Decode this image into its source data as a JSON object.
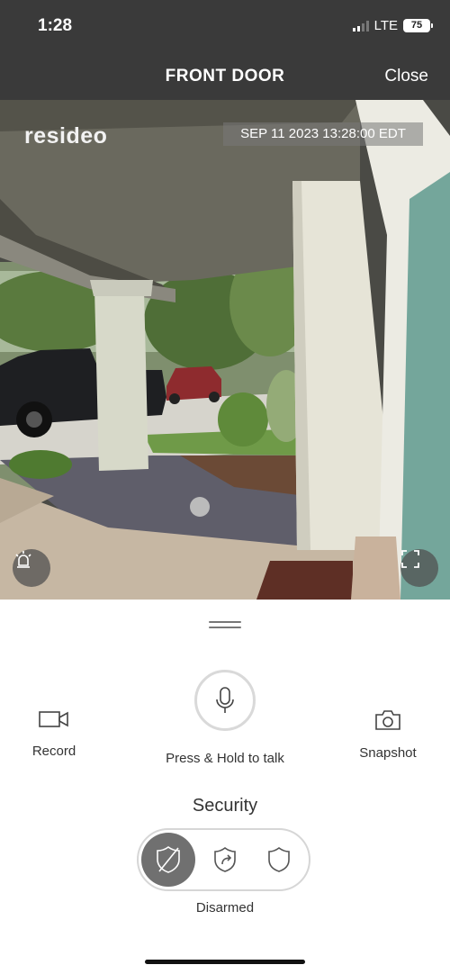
{
  "status_bar": {
    "time": "1:28",
    "network": "LTE",
    "battery": "75"
  },
  "header": {
    "title": "FRONT DOOR",
    "close_label": "Close"
  },
  "feed": {
    "brand": "resideo",
    "timestamp": "SEP 11 2023 13:28:00 EDT"
  },
  "icons": {
    "alarm": "siren-icon",
    "fullscreen": "fullscreen-icon",
    "record": "video-camera-icon",
    "talk": "microphone-icon",
    "snapshot": "camera-icon",
    "disarmed": "shield-off-icon",
    "away": "shield-arrow-icon",
    "armed": "shield-icon"
  },
  "actions": {
    "record_label": "Record",
    "talk_label": "Press & Hold to talk",
    "snapshot_label": "Snapshot"
  },
  "security": {
    "title": "Security",
    "current_mode": "Disarmed"
  },
  "colors": {
    "header_bg": "#3a3a3a",
    "active_segment": "#707070"
  }
}
